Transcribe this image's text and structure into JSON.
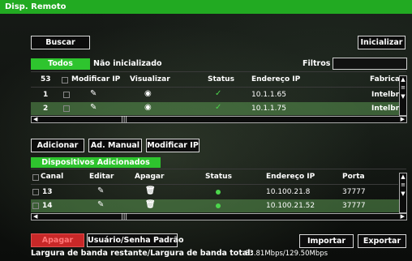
{
  "window": {
    "title": "Disp. Remoto"
  },
  "toolbar": {
    "search": "Buscar",
    "initialize": "Inicializar"
  },
  "filter_tabs": {
    "all": "Todos",
    "uninitialized": "Não inicializado",
    "filters_label": "Filtros",
    "filters_value": ""
  },
  "search_table": {
    "count": "53",
    "columns": [
      "Modificar IP",
      "Visualizar",
      "Status",
      "Endereço IP",
      "Fabrica"
    ],
    "rows": [
      {
        "index": "1",
        "ip": "10.1.1.65",
        "maker": "Intelbra"
      },
      {
        "index": "2",
        "ip": "10.1.1.75",
        "maker": "Intelbra"
      }
    ]
  },
  "actions": {
    "add": "Adicionar",
    "manual_add": "Ad. Manual",
    "modify_ip": "Modificar IP"
  },
  "added_tab": "Dispositivos Adicionados",
  "added_table": {
    "columns": [
      "Canal",
      "Editar",
      "Apagar",
      "Status",
      "Endereço IP",
      "Porta"
    ],
    "rows": [
      {
        "channel": "13",
        "ip": "10.100.21.8",
        "port": "37777"
      },
      {
        "channel": "14",
        "ip": "10.100.21.52",
        "port": "37777"
      }
    ]
  },
  "footer": {
    "delete": "Apagar",
    "default_user": "Usuário/Senha Padrão",
    "import": "Importar",
    "export": "Exportar",
    "bandwidth_label": "Largura de banda restante/Largura de banda total:",
    "bandwidth_value": "83.81Mbps/129.50Mbps"
  },
  "colors": {
    "accent": "#2ec42e",
    "delete_red": "#c82828"
  }
}
